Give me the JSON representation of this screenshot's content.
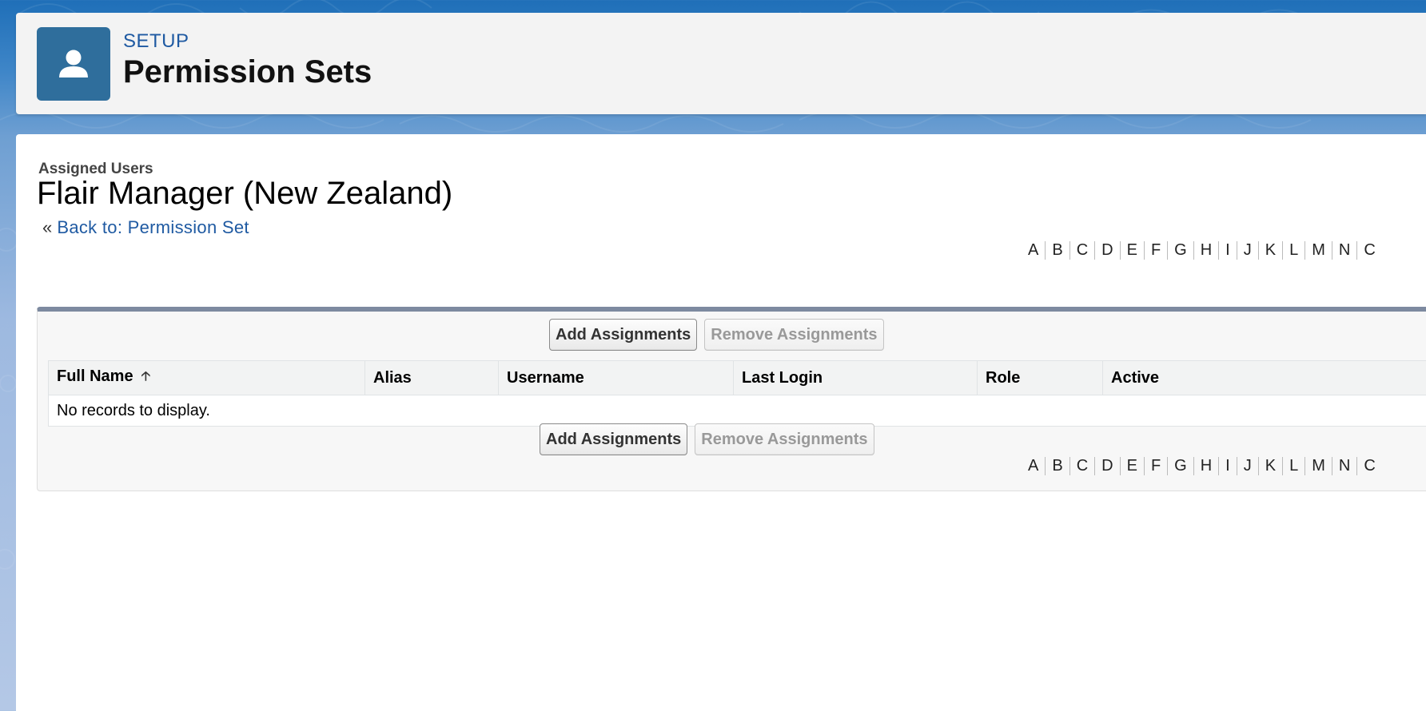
{
  "header": {
    "section": "SETUP",
    "title": "Permission Sets",
    "icon": "user-icon",
    "icon_color": "#2f6e9c"
  },
  "page": {
    "type_label": "Assigned Users",
    "title": "Flair Manager (New Zealand)",
    "back_prefix": "«",
    "back_link": "Back to: Permission Set"
  },
  "alpha_filter": [
    "A",
    "B",
    "C",
    "D",
    "E",
    "F",
    "G",
    "H",
    "I",
    "J",
    "K",
    "L",
    "M",
    "N",
    "C"
  ],
  "buttons": {
    "add": "Add Assignments",
    "remove": "Remove Assignments"
  },
  "table": {
    "columns": [
      "Full Name",
      "Alias",
      "Username",
      "Last Login",
      "Role",
      "Active"
    ],
    "sort_icon": "arrow-up-icon",
    "empty_message": "No records to display."
  },
  "colors": {
    "link": "#1f5aa2",
    "panel_border": "#7d8aa0"
  }
}
